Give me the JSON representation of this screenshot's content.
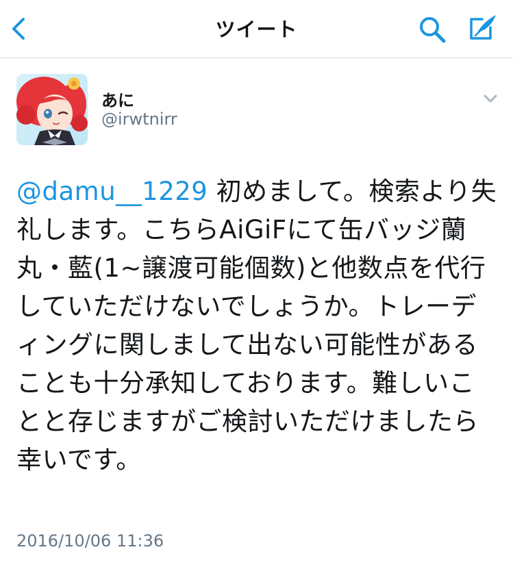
{
  "navbar": {
    "title": "ツイート"
  },
  "colors": {
    "accent": "#1b95e0",
    "text": "#14171a",
    "secondary_text": "#657786",
    "divider": "#d6d9dc"
  },
  "icons": {
    "back": "chevron-left-icon",
    "search": "search-icon",
    "compose": "compose-icon",
    "caret": "chevron-down-icon"
  },
  "tweet": {
    "author": {
      "display_name": "あに",
      "username": "@irwtnirr"
    },
    "mention": "@damu__1229",
    "body": " 初めまして。検索より失礼します。こちらAiGiFにて缶バッジ蘭丸・藍(1~譲渡可能個数)と他数点を代行していただけないでしょうか。トレーディングに関しまして出ない可能性があることも十分承知しております。難しいことと存じますがご検討いただけましたら幸いです。",
    "timestamp": "2016/10/06 11:36"
  }
}
